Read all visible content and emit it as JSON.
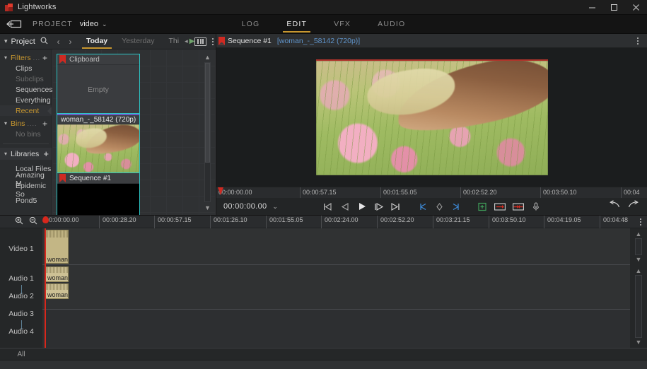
{
  "window": {
    "title": "Lightworks",
    "controls": {
      "minimize": "minimize-button",
      "maximize": "maximize-button",
      "close": "close-button"
    }
  },
  "project_bar": {
    "back_label": "back-arrow",
    "project_label": "PROJECT",
    "project_name": "video",
    "caret": "⌄"
  },
  "modes": [
    {
      "label": "LOG",
      "active": false
    },
    {
      "label": "EDIT",
      "active": true
    },
    {
      "label": "VFX",
      "active": false
    },
    {
      "label": "AUDIO",
      "active": false
    }
  ],
  "browser": {
    "header": {
      "title": "Project",
      "search_icon": "search-icon"
    },
    "nav": {
      "prev": "‹",
      "next": "›"
    },
    "day_tabs": [
      {
        "label": "Today",
        "active": true
      },
      {
        "label": "Yesterday",
        "active": false
      },
      {
        "label": "Thi",
        "active": false
      }
    ],
    "tree": {
      "filters_group": "Filters",
      "filters_dots": "...",
      "filters_items": [
        "Clips",
        "Subclips",
        "Sequences",
        "Everything",
        "Recent"
      ],
      "selected_filter": "Recent",
      "dim_filter": "Subclips",
      "bins_group": "Bins",
      "bins_dots": "....",
      "bins_empty": "No bins",
      "libraries_group": "Libraries",
      "libraries_items": [
        "Local Files",
        "Amazing M",
        "Epidemic So",
        "Pond5"
      ]
    },
    "tiles": [
      {
        "name": "Clipboard",
        "kind": "clipboard",
        "body_text": "Empty"
      },
      {
        "name": "woman_-_58142 (720p)",
        "kind": "media",
        "body_text": ""
      },
      {
        "name": "Sequence #1",
        "kind": "sequence",
        "body_text": "▶▶"
      }
    ]
  },
  "viewer": {
    "title": "Sequence #1",
    "subtitle": "[woman_-_58142 (720p)]",
    "kebab": "more-options",
    "ruler_ticks": [
      "00:00:00.00",
      "00:00:57.15",
      "00:01:55.05",
      "00:02:52.20",
      "00:03:50.10",
      "00:04"
    ],
    "timecode": "00:00:00.00",
    "timecode_caret": "⌄",
    "transport": [
      "go-to-start",
      "step-back",
      "play",
      "step-forward-frame",
      "go-to-end",
      "mark-in",
      "mark-clip",
      "mark-out",
      "add-edit",
      "insert-edit",
      "replace-edit",
      "voiceover"
    ],
    "right_tools": [
      "undo",
      "redo"
    ]
  },
  "timeline": {
    "zoom_in": "zoom-in-icon",
    "zoom_out": "zoom-out-icon",
    "ticks": [
      "00:00:00.00",
      "00:00:28.20",
      "00:00:57.15",
      "00:01:26.10",
      "00:01:55.05",
      "00:02:24.00",
      "00:02:52.20",
      "00:03:21.15",
      "00:03:50.10",
      "00:04:19.05",
      "00:04:48"
    ],
    "kebab": "timeline-options",
    "tracks": [
      {
        "label": "Video 1",
        "clip": "woman_"
      },
      {
        "label": "Audio 1",
        "clip": "woman_"
      },
      {
        "label": "Audio 2",
        "clip": "woman_"
      },
      {
        "label": "Audio 3",
        "clip": ""
      },
      {
        "label": "Audio 4",
        "clip": ""
      }
    ],
    "footer_label": "All"
  },
  "colors": {
    "accent_gold": "#c8972f",
    "selection_cyan": "#2cc6c6",
    "playhead_red": "#d8271c",
    "clip_tan": "#c3b685",
    "link_blue": "#5f93c9"
  }
}
